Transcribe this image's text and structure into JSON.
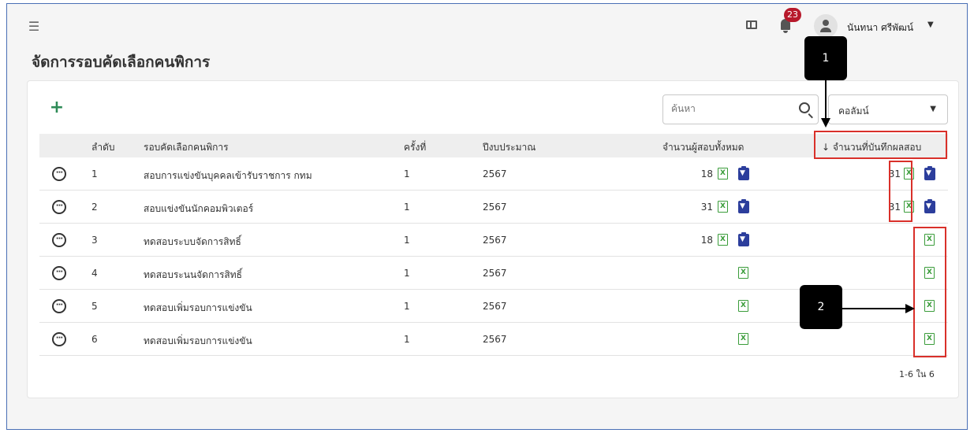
{
  "header": {
    "page_title": "จัดการรอบคัดเลือกคนพิการ",
    "notification_count": "23",
    "user_name": "นันทนา ศรีพัฒน์"
  },
  "toolbar": {
    "add_label": "+",
    "search_placeholder": "ค้นหา",
    "column_select_label": "คอลัมน์"
  },
  "table": {
    "columns": [
      "ลำดับ",
      "รอบคัดเลือกคนพิการ",
      "ครั้งที่",
      "ปีงบประมาณ",
      "จำนวนผู้สอบทั้งหมด",
      "↓ จำนวนที่บันทึกผลสอบ"
    ],
    "rows": [
      {
        "order": "1",
        "name": "สอบการแข่งขันบุคคลเข้ารับราชการ กทม",
        "round": "1",
        "year": "2567",
        "total": "18",
        "recorded": "31"
      },
      {
        "order": "2",
        "name": "สอบแข่งขันนักคอมพิวเตอร์",
        "round": "1",
        "year": "2567",
        "total": "31",
        "recorded": "31"
      },
      {
        "order": "3",
        "name": "ทดสอบระบบจัดการสิทธิ์",
        "round": "1",
        "year": "2567",
        "total": "18",
        "recorded": ""
      },
      {
        "order": "4",
        "name": "ทดสอบระนนจัดการสิทธิ์",
        "round": "1",
        "year": "2567",
        "total": "",
        "recorded": ""
      },
      {
        "order": "5",
        "name": "ทดสอบเพิ่มรอบการแข่งขัน",
        "round": "1",
        "year": "2567",
        "total": "",
        "recorded": ""
      },
      {
        "order": "6",
        "name": "ทดสอบเพิ่มรอบการแข่งขัน",
        "round": "1",
        "year": "2567",
        "total": "",
        "recorded": ""
      }
    ]
  },
  "pagination": {
    "text": "1-6 ใน 6"
  },
  "annotations": {
    "callout_1": "1",
    "callout_2": "2"
  },
  "colors": {
    "accent_green": "#2e8b57",
    "excel_green": "#3a9c3a",
    "download_blue": "#2c3e9c",
    "badge_red": "#b7192b",
    "highlight_red": "#d9302a"
  },
  "icons": [
    "menu-collapse-icon",
    "book-icon",
    "bell-icon",
    "user-avatar-icon",
    "search-icon",
    "more-options-icon",
    "excel-icon",
    "download-icon"
  ]
}
